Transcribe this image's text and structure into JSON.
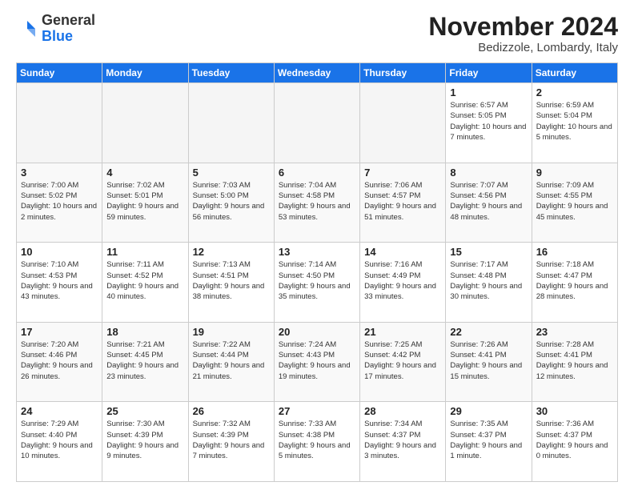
{
  "logo": {
    "general": "General",
    "blue": "Blue"
  },
  "header": {
    "title": "November 2024",
    "subtitle": "Bedizzole, Lombardy, Italy"
  },
  "weekdays": [
    "Sunday",
    "Monday",
    "Tuesday",
    "Wednesday",
    "Thursday",
    "Friday",
    "Saturday"
  ],
  "weeks": [
    [
      {
        "day": "",
        "info": ""
      },
      {
        "day": "",
        "info": ""
      },
      {
        "day": "",
        "info": ""
      },
      {
        "day": "",
        "info": ""
      },
      {
        "day": "",
        "info": ""
      },
      {
        "day": "1",
        "info": "Sunrise: 6:57 AM\nSunset: 5:05 PM\nDaylight: 10 hours and 7 minutes."
      },
      {
        "day": "2",
        "info": "Sunrise: 6:59 AM\nSunset: 5:04 PM\nDaylight: 10 hours and 5 minutes."
      }
    ],
    [
      {
        "day": "3",
        "info": "Sunrise: 7:00 AM\nSunset: 5:02 PM\nDaylight: 10 hours and 2 minutes."
      },
      {
        "day": "4",
        "info": "Sunrise: 7:02 AM\nSunset: 5:01 PM\nDaylight: 9 hours and 59 minutes."
      },
      {
        "day": "5",
        "info": "Sunrise: 7:03 AM\nSunset: 5:00 PM\nDaylight: 9 hours and 56 minutes."
      },
      {
        "day": "6",
        "info": "Sunrise: 7:04 AM\nSunset: 4:58 PM\nDaylight: 9 hours and 53 minutes."
      },
      {
        "day": "7",
        "info": "Sunrise: 7:06 AM\nSunset: 4:57 PM\nDaylight: 9 hours and 51 minutes."
      },
      {
        "day": "8",
        "info": "Sunrise: 7:07 AM\nSunset: 4:56 PM\nDaylight: 9 hours and 48 minutes."
      },
      {
        "day": "9",
        "info": "Sunrise: 7:09 AM\nSunset: 4:55 PM\nDaylight: 9 hours and 45 minutes."
      }
    ],
    [
      {
        "day": "10",
        "info": "Sunrise: 7:10 AM\nSunset: 4:53 PM\nDaylight: 9 hours and 43 minutes."
      },
      {
        "day": "11",
        "info": "Sunrise: 7:11 AM\nSunset: 4:52 PM\nDaylight: 9 hours and 40 minutes."
      },
      {
        "day": "12",
        "info": "Sunrise: 7:13 AM\nSunset: 4:51 PM\nDaylight: 9 hours and 38 minutes."
      },
      {
        "day": "13",
        "info": "Sunrise: 7:14 AM\nSunset: 4:50 PM\nDaylight: 9 hours and 35 minutes."
      },
      {
        "day": "14",
        "info": "Sunrise: 7:16 AM\nSunset: 4:49 PM\nDaylight: 9 hours and 33 minutes."
      },
      {
        "day": "15",
        "info": "Sunrise: 7:17 AM\nSunset: 4:48 PM\nDaylight: 9 hours and 30 minutes."
      },
      {
        "day": "16",
        "info": "Sunrise: 7:18 AM\nSunset: 4:47 PM\nDaylight: 9 hours and 28 minutes."
      }
    ],
    [
      {
        "day": "17",
        "info": "Sunrise: 7:20 AM\nSunset: 4:46 PM\nDaylight: 9 hours and 26 minutes."
      },
      {
        "day": "18",
        "info": "Sunrise: 7:21 AM\nSunset: 4:45 PM\nDaylight: 9 hours and 23 minutes."
      },
      {
        "day": "19",
        "info": "Sunrise: 7:22 AM\nSunset: 4:44 PM\nDaylight: 9 hours and 21 minutes."
      },
      {
        "day": "20",
        "info": "Sunrise: 7:24 AM\nSunset: 4:43 PM\nDaylight: 9 hours and 19 minutes."
      },
      {
        "day": "21",
        "info": "Sunrise: 7:25 AM\nSunset: 4:42 PM\nDaylight: 9 hours and 17 minutes."
      },
      {
        "day": "22",
        "info": "Sunrise: 7:26 AM\nSunset: 4:41 PM\nDaylight: 9 hours and 15 minutes."
      },
      {
        "day": "23",
        "info": "Sunrise: 7:28 AM\nSunset: 4:41 PM\nDaylight: 9 hours and 12 minutes."
      }
    ],
    [
      {
        "day": "24",
        "info": "Sunrise: 7:29 AM\nSunset: 4:40 PM\nDaylight: 9 hours and 10 minutes."
      },
      {
        "day": "25",
        "info": "Sunrise: 7:30 AM\nSunset: 4:39 PM\nDaylight: 9 hours and 9 minutes."
      },
      {
        "day": "26",
        "info": "Sunrise: 7:32 AM\nSunset: 4:39 PM\nDaylight: 9 hours and 7 minutes."
      },
      {
        "day": "27",
        "info": "Sunrise: 7:33 AM\nSunset: 4:38 PM\nDaylight: 9 hours and 5 minutes."
      },
      {
        "day": "28",
        "info": "Sunrise: 7:34 AM\nSunset: 4:37 PM\nDaylight: 9 hours and 3 minutes."
      },
      {
        "day": "29",
        "info": "Sunrise: 7:35 AM\nSunset: 4:37 PM\nDaylight: 9 hours and 1 minute."
      },
      {
        "day": "30",
        "info": "Sunrise: 7:36 AM\nSunset: 4:37 PM\nDaylight: 9 hours and 0 minutes."
      }
    ]
  ]
}
